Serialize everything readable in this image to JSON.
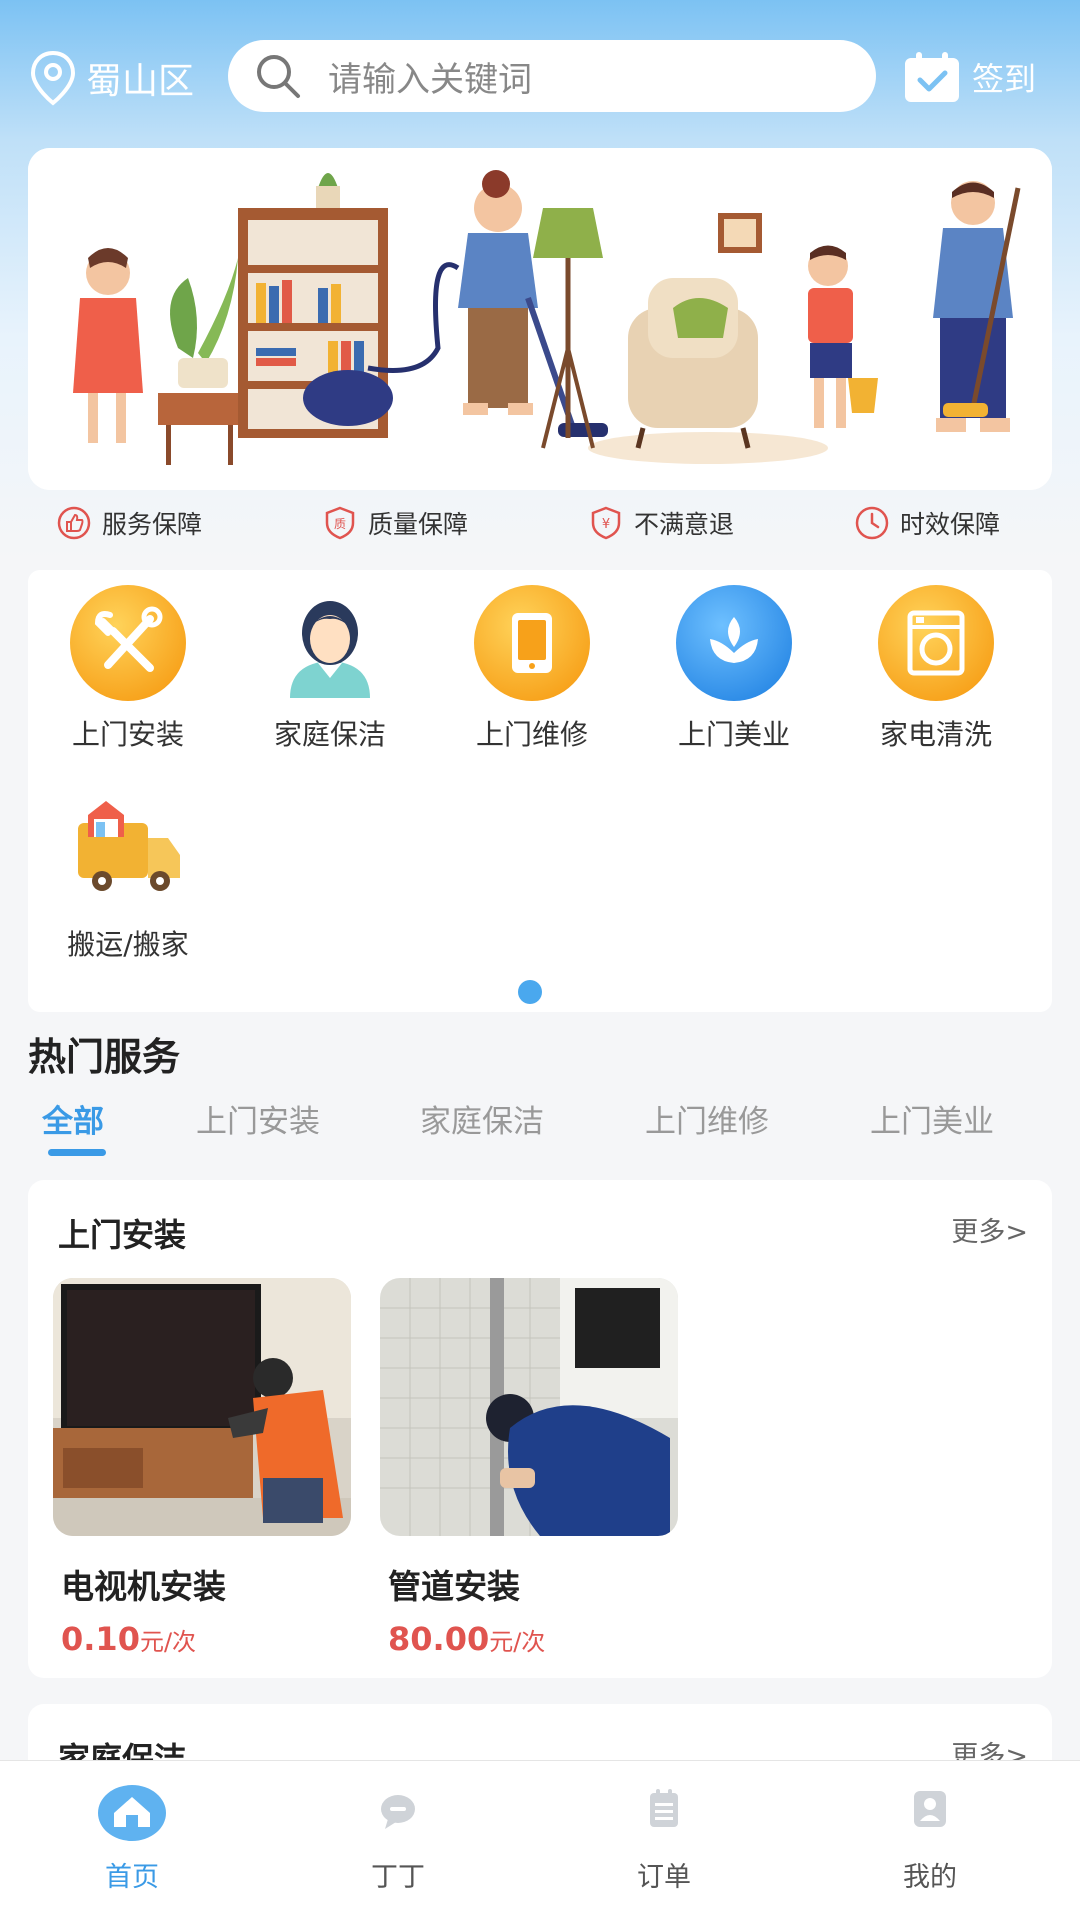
{
  "header": {
    "location": "蜀山区",
    "search_placeholder": "请输入关键词",
    "signin_label": "签到"
  },
  "guarantees": [
    "服务保障",
    "质量保障",
    "不满意退",
    "时效保障"
  ],
  "categories": [
    {
      "label": "上门安装",
      "icon": "tools-icon"
    },
    {
      "label": "家庭保洁",
      "icon": "cleaner-person-icon"
    },
    {
      "label": "上门维修",
      "icon": "phone-repair-icon"
    },
    {
      "label": "上门美业",
      "icon": "lotus-beauty-icon"
    },
    {
      "label": "家电清洗",
      "icon": "washing-machine-icon"
    },
    {
      "label": "搬运/搬家",
      "icon": "moving-truck-icon"
    }
  ],
  "hot": {
    "title": "热门服务",
    "tabs": [
      "全部",
      "上门安装",
      "家庭保洁",
      "上门维修",
      "上门美业"
    ],
    "active_tab": 0
  },
  "sections": [
    {
      "title": "上门安装",
      "more": "更多>",
      "products": [
        {
          "name": "电视机安装",
          "price": "0.10",
          "unit": "元/次"
        },
        {
          "name": "管道安装",
          "price": "80.00",
          "unit": "元/次"
        }
      ]
    },
    {
      "title": "家庭保洁",
      "more": "更多>"
    }
  ],
  "nav": [
    {
      "label": "首页",
      "icon": "home-icon",
      "active": true
    },
    {
      "label": "丁丁",
      "icon": "chat-icon",
      "active": false
    },
    {
      "label": "订单",
      "icon": "order-list-icon",
      "active": false
    },
    {
      "label": "我的",
      "icon": "profile-icon",
      "active": false
    }
  ],
  "colors": {
    "accent": "#3a9ae6",
    "price": "#e0544f",
    "guarantee_icon": "#e0544f"
  }
}
